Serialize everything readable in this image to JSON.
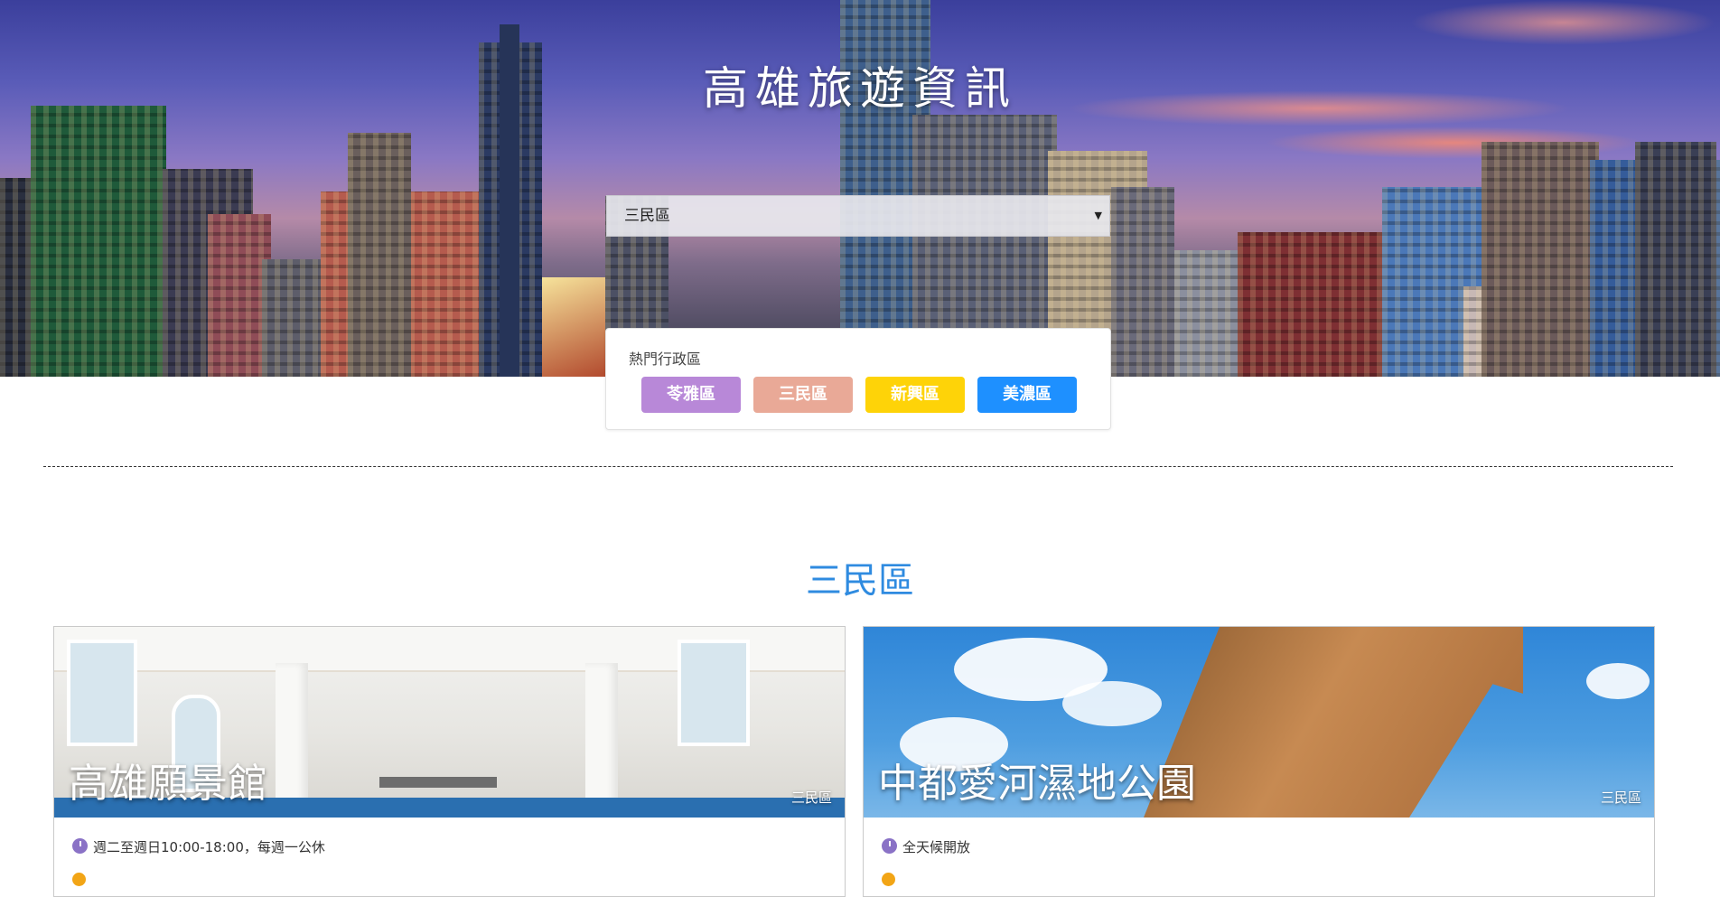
{
  "header": {
    "title": "高雄旅遊資訊"
  },
  "district_select": {
    "selected": "三民區"
  },
  "hot_districts": {
    "title": "熱門行政區",
    "items": [
      {
        "label": "苓雅區",
        "color": "#b888d8"
      },
      {
        "label": "三民區",
        "color": "#e9a997"
      },
      {
        "label": "新興區",
        "color": "#fed308"
      },
      {
        "label": "美濃區",
        "color": "#1e90ff"
      }
    ]
  },
  "section": {
    "title": "三民區"
  },
  "spots": [
    {
      "name": "高雄願景館",
      "zone": "三民區",
      "hours": "週二至週日10:00-18:00，每週一公休"
    },
    {
      "name": "中都愛河濕地公園",
      "zone": "三民區",
      "hours": "全天候開放"
    }
  ],
  "icons": {
    "hours": "clock-icon",
    "select_arrow": "caret-down-icon"
  }
}
